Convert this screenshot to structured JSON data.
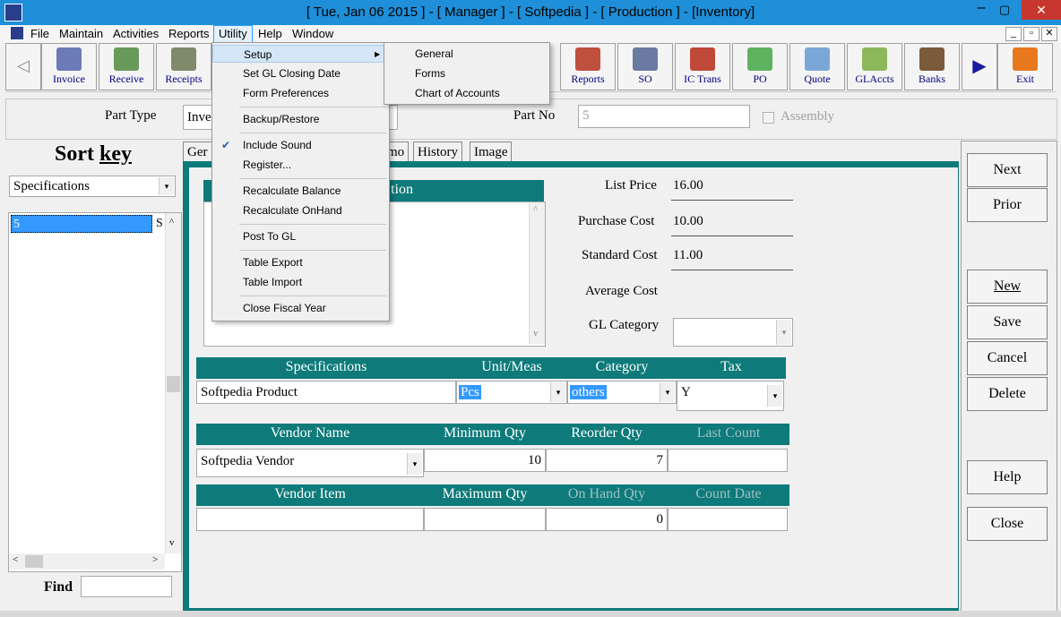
{
  "window": {
    "title": "[ Tue, Jan 06 2015 ] - [ Manager ] - [ Softpedia ] - [ Production ] - [Inventory]",
    "close": "✕",
    "minimize": "–",
    "maximize": "▢"
  },
  "menubar": [
    "File",
    "Maintain",
    "Activities",
    "Reports",
    "Utility",
    "Help",
    "Window"
  ],
  "mdi_buttons": [
    "_",
    "▫",
    "✕"
  ],
  "toolbar": {
    "left": [
      {
        "label": "Invoice",
        "color": "#6a7bb8"
      },
      {
        "label": "Receive",
        "color": "#6a9a5a"
      },
      {
        "label": "Receipts",
        "color": "#7f8a6a"
      }
    ],
    "right": [
      {
        "label": "Reports",
        "color": "#c0503e"
      },
      {
        "label": "SO",
        "color": "#6b7aa0"
      },
      {
        "label": "IC Trans",
        "color": "#c04a3a"
      },
      {
        "label": "PO",
        "color": "#5fb35f"
      },
      {
        "label": "Quote",
        "color": "#7aa7d8"
      },
      {
        "label": "GLAccts",
        "color": "#8cb85a"
      },
      {
        "label": "Banks",
        "color": "#7a5a3a"
      },
      {
        "label": "",
        "color": "#1a1aa0"
      },
      {
        "label": "Exit",
        "color": "#e8781e"
      }
    ]
  },
  "utility_menu": {
    "items": [
      {
        "label": "Setup",
        "arrow": "▶"
      },
      {
        "label": "Set GL Closing Date"
      },
      {
        "label": "Form Preferences"
      },
      {
        "label": "Backup/Restore"
      },
      {
        "label": "Include Sound",
        "check": "✔"
      },
      {
        "label": "Register..."
      },
      {
        "label": "Recalculate Balance"
      },
      {
        "label": "Recalculate OnHand"
      },
      {
        "label": "Post To GL"
      },
      {
        "label": "Table Export"
      },
      {
        "label": "Table Import"
      },
      {
        "label": "Close Fiscal Year"
      }
    ],
    "setup_submenu": [
      "General",
      "Forms",
      "Chart of Accounts"
    ]
  },
  "header": {
    "part_type_label": "Part Type",
    "part_type_value": "Inve",
    "part_no_label": "Part No",
    "part_no_value": "5",
    "assembly_label": "Assembly"
  },
  "sort": {
    "title_pre": "Sort ",
    "title_key": "key",
    "selected": "Specifications",
    "list": [
      {
        "col1": "5",
        "col2": "S"
      }
    ],
    "find_label": "Find",
    "find_value": ""
  },
  "tabs": [
    "Ger",
    "mo",
    "History",
    "Image"
  ],
  "description_header": "tion",
  "description_text": "",
  "costs": {
    "list_price_label": "List Price",
    "list_price": "16.00",
    "purchase_cost_label": "Purchase Cost",
    "purchase_cost": "10.00",
    "standard_cost_label": "Standard Cost",
    "standard_cost": "11.00",
    "average_cost_label": "Average Cost",
    "average_cost": "",
    "gl_category_label": "GL Category",
    "gl_category": ""
  },
  "grid1": {
    "headers": [
      "Specifications",
      "Unit/Meas",
      "Category",
      "Tax"
    ],
    "values": [
      "Softpedia Product",
      "Pcs",
      "others",
      "Y"
    ]
  },
  "grid2": {
    "headers": [
      "Vendor Name",
      "Minimum Qty",
      "Reorder Qty",
      "Last Count"
    ],
    "values": [
      "Softpedia Vendor",
      "10",
      "7",
      ""
    ]
  },
  "grid3": {
    "headers": [
      "Vendor Item",
      "Maximum Qty",
      "On Hand Qty",
      "Count Date"
    ],
    "values": [
      "",
      "",
      "0",
      ""
    ]
  },
  "buttons": {
    "next": "Next",
    "prior": "Prior",
    "new": "New",
    "save": "Save",
    "cancel": "Cancel",
    "delete": "Delete",
    "help": "Help",
    "close": "Close"
  },
  "icons": {
    "dropdown": "▾",
    "scroll_up": "^",
    "scroll_down": "v",
    "scroll_left": "<",
    "scroll_right": ">",
    "back": "◁",
    "play": "▶"
  }
}
